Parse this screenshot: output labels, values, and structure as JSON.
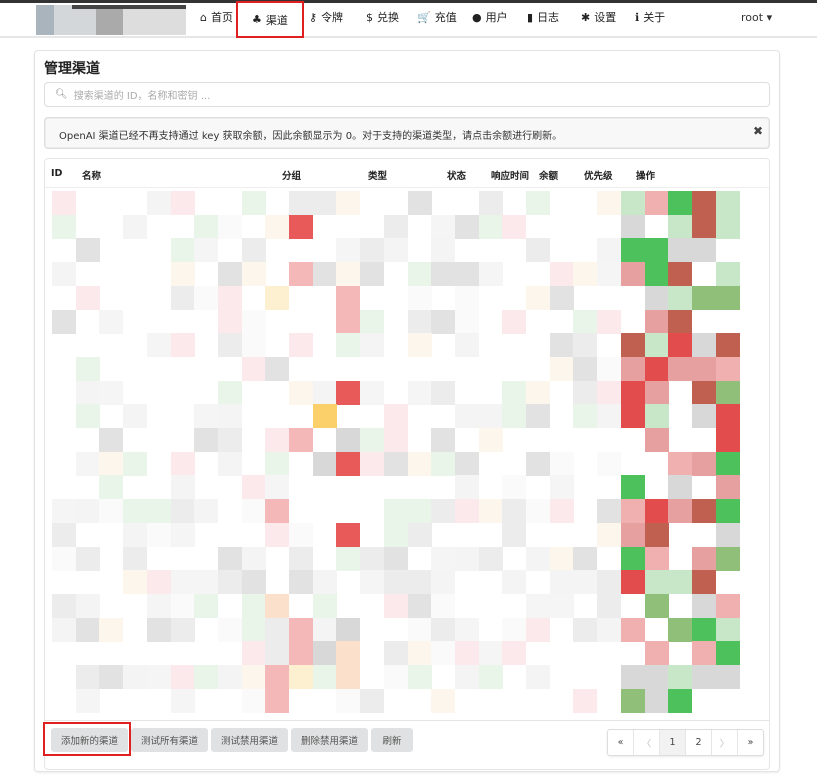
{
  "nav": {
    "items": [
      {
        "label": "首页",
        "icon": "home-icon",
        "glyph": "⌂"
      },
      {
        "label": "渠道",
        "icon": "sitemap-icon",
        "glyph": "♣",
        "active": true
      },
      {
        "label": "令牌",
        "icon": "key-icon",
        "glyph": "⚷"
      },
      {
        "label": "兑换",
        "icon": "dollar-icon",
        "glyph": "$"
      },
      {
        "label": "充值",
        "icon": "cart-icon",
        "glyph": "🛒"
      },
      {
        "label": "用户",
        "icon": "user-icon",
        "glyph": "●"
      },
      {
        "label": "日志",
        "icon": "book-icon",
        "glyph": "▮"
      },
      {
        "label": "设置",
        "icon": "gear-icon",
        "glyph": "✱"
      },
      {
        "label": "关于",
        "icon": "info-icon",
        "glyph": "ℹ"
      }
    ],
    "user": "root"
  },
  "page": {
    "title": "管理渠道",
    "search_placeholder": "搜索渠道的 ID，名称和密钥 ...",
    "alert": "OpenAI 渠道已经不再支持通过 key 获取余额，因此余额显示为 0。对于支持的渠道类型，请点击余额进行刷新。",
    "alert_close": "✖"
  },
  "table": {
    "headers": [
      "ID",
      "名称",
      "分组",
      "类型",
      "状态",
      "响应时间",
      "余额",
      "优先级",
      "操作"
    ]
  },
  "footer": {
    "buttons": [
      "添加新的渠道",
      "测试所有渠道",
      "测试禁用渠道",
      "删除禁用渠道",
      "刷新"
    ],
    "pagination": [
      "«",
      "〈",
      "1",
      "2",
      "〉",
      "»"
    ],
    "current_page": "1"
  }
}
